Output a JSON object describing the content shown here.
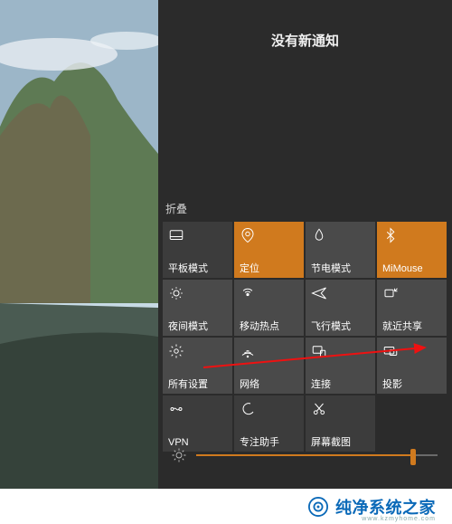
{
  "panel": {
    "title": "没有新通知",
    "collapse_label": "折叠"
  },
  "tiles": [
    [
      {
        "icon": "tablet-mode-icon",
        "label": "平板模式",
        "variant": "dim"
      },
      {
        "icon": "location-icon",
        "label": "定位",
        "variant": "orange"
      },
      {
        "icon": "battery-saver-icon",
        "label": "节电模式",
        "variant": ""
      },
      {
        "icon": "bluetooth-icon",
        "label": "MiMouse",
        "variant": "orange"
      }
    ],
    [
      {
        "icon": "night-light-icon",
        "label": "夜间模式",
        "variant": ""
      },
      {
        "icon": "hotspot-icon",
        "label": "移动热点",
        "variant": ""
      },
      {
        "icon": "airplane-icon",
        "label": "飞行模式",
        "variant": ""
      },
      {
        "icon": "nearby-share-icon",
        "label": "就近共享",
        "variant": ""
      }
    ],
    [
      {
        "icon": "settings-icon",
        "label": "所有设置",
        "variant": ""
      },
      {
        "icon": "network-icon",
        "label": "网络",
        "variant": ""
      },
      {
        "icon": "connect-icon",
        "label": "连接",
        "variant": ""
      },
      {
        "icon": "project-icon",
        "label": "投影",
        "variant": ""
      }
    ],
    [
      {
        "icon": "vpn-icon",
        "label": "VPN",
        "variant": "dim"
      },
      {
        "icon": "focus-assist-icon",
        "label": "专注助手",
        "variant": "dim"
      },
      {
        "icon": "snip-icon",
        "label": "屏幕截图",
        "variant": "dim"
      },
      {
        "icon": "",
        "label": "",
        "variant": "empty"
      }
    ]
  ],
  "brightness": {
    "percent": 90
  },
  "watermark": {
    "text": "纯净系统之家",
    "sub": "www.kzmyhome.com"
  },
  "colors": {
    "accent": "#d07a1e",
    "panel_bg": "#2b2b2b",
    "tile_bg": "#4a4a4a"
  }
}
